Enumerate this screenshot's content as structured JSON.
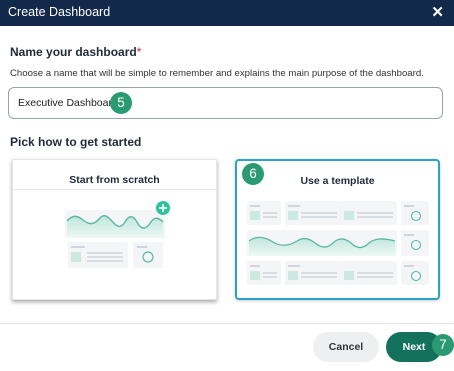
{
  "dialog": {
    "title": "Create Dashboard",
    "close_glyph": "✕"
  },
  "name_section": {
    "heading": "Name your dashboard",
    "required_mark": "*",
    "help": "Choose a name that will be simple to remember and explains the main purpose of the dashboard.",
    "input_value": "Executive Dashboard"
  },
  "pick_section": {
    "heading": "Pick how to get started"
  },
  "cards": {
    "scratch": {
      "label": "Start from scratch",
      "add_icon": "plus-icon"
    },
    "template": {
      "label": "Use a template"
    }
  },
  "badges": {
    "input": "5",
    "template": "6",
    "next": "7"
  },
  "footer": {
    "cancel_label": "Cancel",
    "next_label": "Next"
  },
  "colors": {
    "header": "#13294b",
    "accent_teal": "#2a9a72",
    "primary_button": "#13715c",
    "selection_border": "#2aa3c6",
    "required": "#c62828"
  }
}
